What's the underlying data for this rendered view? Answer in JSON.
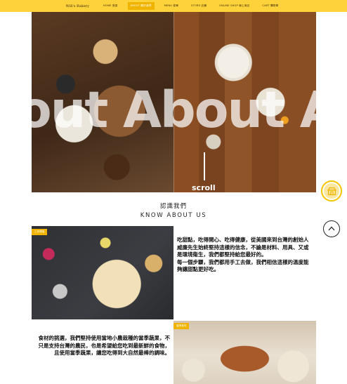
{
  "nav": {
    "brand": "Will's Bakery",
    "items": [
      {
        "label": "HOME 首頁",
        "active": false
      },
      {
        "label": "ABOUT 關於我們",
        "active": true
      },
      {
        "label": "MENU 菜單",
        "active": false
      },
      {
        "label": "STORE 店舖",
        "active": false
      },
      {
        "label": "ONLINE SHOP 線上商店",
        "active": false
      },
      {
        "label": "CART 購物車",
        "active": false
      }
    ]
  },
  "hero": {
    "word": "out About Abo",
    "scroll_label": "scroll"
  },
  "about": {
    "title_cn": "認識我們",
    "title_en": "KNOW ABOUT US"
  },
  "tags": {
    "tag1": "工作環境",
    "tag2": "當季食材"
  },
  "text_blocks": {
    "block1": "吃甜點，吃得開心、吃得健康，從美國來到台灣的創始人威廉先生始終堅持這樣的信念，不論是材料、用具、又或是環境衛生，我們都堅持給您最好的。\n每一個步驟，我們都用手工去做，我們相信這樣的溫度能夠讓甜點更好吃。",
    "block2": "食材的挑選，我們堅持使用當地小農栽種的當季蔬果，不只是支持台灣的農民，也是希望給您吃到最新鮮的食物，且使用當季蔬果，讓您吃得到大自然最棒的調味。"
  },
  "colors": {
    "accent": "#fdd23a",
    "active_nav": "#f0b400"
  },
  "icons": {
    "cart": "cart-icon",
    "scroll_top": "chevron-up-icon"
  }
}
